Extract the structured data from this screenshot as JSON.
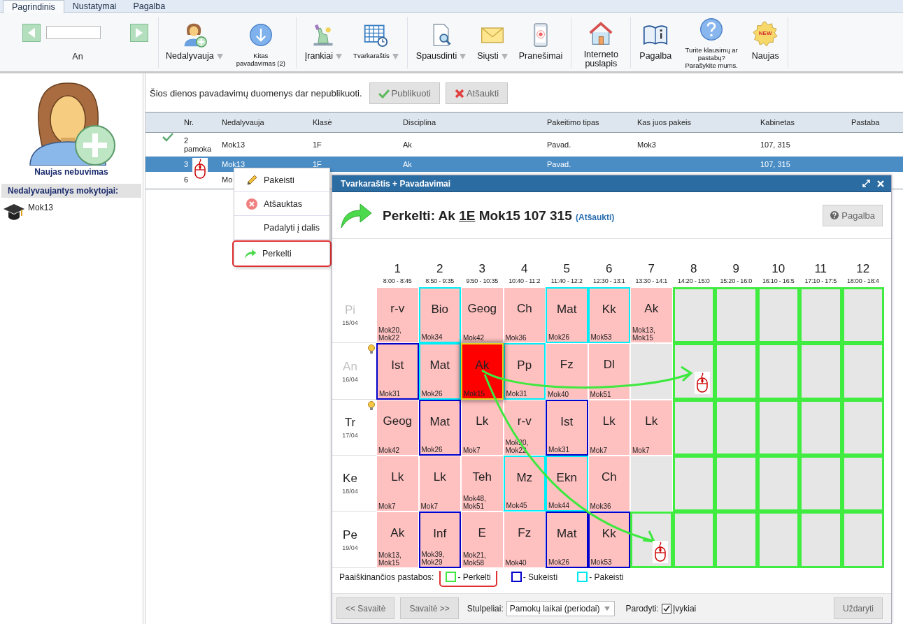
{
  "menu_tabs": [
    {
      "label": "Pagrindinis",
      "selected": true
    },
    {
      "label": "Nustatymai",
      "selected": false
    },
    {
      "label": "Pagalba",
      "selected": false
    }
  ],
  "toolbar": {
    "day_label": "An",
    "groups": [
      [
        {
          "label": "Nedalyvauja",
          "dropdown": true
        },
        {
          "label": "Kitas pavadavimas (2)",
          "dropdown": false
        }
      ],
      [
        {
          "label": "Įrankiai",
          "dropdown": true
        },
        {
          "label": "Tvarkaraštis",
          "dropdown": true
        }
      ],
      [
        {
          "label": "Spausdinti",
          "dropdown": true
        },
        {
          "label": "Siųsti",
          "dropdown": true
        },
        {
          "label": "Pranešimai",
          "dropdown": false
        }
      ],
      [
        {
          "label": "Interneto puslapis",
          "dropdown": false
        }
      ],
      [
        {
          "label": "Pagalba",
          "dropdown": false
        },
        {
          "label": "Turite klausimų ar pastabų? Parašykite mums.",
          "dropdown": false
        },
        {
          "label": "Naujas",
          "badge": "NEW",
          "dropdown": false
        }
      ]
    ]
  },
  "sidebar": {
    "new_absence": "Naujas nebuvimas",
    "heading": "Nedalyvaujantys mokytojai:",
    "teachers": [
      "Mok13"
    ]
  },
  "notice": {
    "text": "Šios dienos pavadavimų duomenys dar nepublikuoti.",
    "buttons": [
      "Publikuoti",
      "Atšaukti"
    ]
  },
  "table": {
    "columns": [
      "Nr.",
      "Nedalyvauja",
      "Klasė",
      "Disciplina",
      "Pakeitimo tipas",
      "Kas juos pakeis",
      "Kabinetas",
      "Pastaba"
    ],
    "rows": [
      {
        "published": true,
        "selected": false,
        "nr": "2\npamoka",
        "absent": "Mok13",
        "class": "1F",
        "subject": "Ak",
        "type": "Pavad.",
        "substitute": "Mok3",
        "room": "107, 315"
      },
      {
        "published": false,
        "selected": true,
        "nr": "3",
        "absent": "Mok13",
        "class": "1F",
        "subject": "Ak",
        "type": "Pavad.",
        "room": "107, 315"
      },
      {
        "published": false,
        "selected": false,
        "nr": "6",
        "absent": "Mo"
      }
    ]
  },
  "context_menu": [
    {
      "label": "Pakeisti",
      "highlighted": false
    },
    {
      "label": "Atšauktas",
      "highlighted": false
    },
    {
      "label": "Padalyti į dalis",
      "highlighted": false
    },
    {
      "label": "Perkelti",
      "highlighted": true
    }
  ],
  "dialog": {
    "title": "Tvarkaraštis + Pavadavimai",
    "heading": {
      "verb": "Perkelti: Ak",
      "class": "1E",
      "rest": "Mok15 107 315",
      "cancel_link": "(Atšaukti)"
    },
    "help_button": "Pagalba",
    "periods": [
      {
        "number": "1",
        "time": "8:00 - 8:45"
      },
      {
        "number": "2",
        "time": "8:50 - 9:35"
      },
      {
        "number": "3",
        "time": "9:50 - 10:35"
      },
      {
        "number": "4",
        "time": "10:40 - 11:2"
      },
      {
        "number": "5",
        "time": "11:40 - 12:2"
      },
      {
        "number": "6",
        "time": "12:30 - 13:1"
      },
      {
        "number": "7",
        "time": "13:30 - 14:1"
      },
      {
        "number": "8",
        "time": "14:20 - 15:0"
      },
      {
        "number": "9",
        "time": "15:20 - 16:0"
      },
      {
        "number": "10",
        "time": "16:10 - 16:5"
      },
      {
        "number": "11",
        "time": "17:10 - 17:5"
      },
      {
        "number": "12",
        "time": "18:00 - 18:4"
      }
    ],
    "days": [
      {
        "name": "Pi",
        "date": "15/04",
        "past": true,
        "hint": false,
        "cells": [
          {
            "subject": "r-v",
            "teachers": "Mok20, Mok22",
            "kind": "none"
          },
          {
            "subject": "Bio",
            "teachers": "Mok34",
            "kind": "replace"
          },
          {
            "subject": "Geog",
            "teachers": "Mok42",
            "kind": "none"
          },
          {
            "subject": "Ch",
            "teachers": "Mok36",
            "kind": "none"
          },
          {
            "subject": "Mat",
            "teachers": "Mok26",
            "kind": "replace"
          },
          {
            "subject": "Kk",
            "teachers": "Mok53",
            "kind": "replace"
          },
          {
            "subject": "Ak",
            "teachers": "Mok13, Mok15",
            "kind": "none"
          },
          {
            "kind": "move"
          },
          {
            "kind": "move"
          },
          {
            "kind": "move"
          },
          {
            "kind": "move"
          },
          {
            "kind": "move"
          }
        ]
      },
      {
        "name": "An",
        "date": "16/04",
        "past": true,
        "hint": true,
        "cells": [
          {
            "subject": "Ist",
            "teachers": "Mok31",
            "kind": "swap"
          },
          {
            "subject": "Mat",
            "teachers": "Mok26",
            "kind": "replace"
          },
          {
            "subject": "Ak",
            "teachers": "Mok15",
            "kind": "current"
          },
          {
            "subject": "Pp",
            "teachers": "Mok31",
            "kind": "replace"
          },
          {
            "subject": "Fz",
            "teachers": "Mok40",
            "kind": "none"
          },
          {
            "subject": "Dl",
            "teachers": "Mok51",
            "kind": "none"
          },
          {
            "kind": "none"
          },
          {
            "kind": "move"
          },
          {
            "kind": "move"
          },
          {
            "kind": "move"
          },
          {
            "kind": "move"
          },
          {
            "kind": "move"
          }
        ]
      },
      {
        "name": "Tr",
        "date": "17/04",
        "past": false,
        "hint": true,
        "cells": [
          {
            "subject": "Geog",
            "teachers": "Mok42",
            "kind": "none"
          },
          {
            "subject": "Mat",
            "teachers": "Mok26",
            "kind": "swap"
          },
          {
            "subject": "Lk",
            "teachers": "Mok7",
            "kind": "none"
          },
          {
            "subject": "r-v",
            "teachers": "Mok20, Mok22",
            "kind": "none"
          },
          {
            "subject": "Ist",
            "teachers": "Mok31",
            "kind": "swap"
          },
          {
            "subject": "Lk",
            "teachers": "Mok7",
            "kind": "none"
          },
          {
            "subject": "Lk",
            "teachers": "Mok7",
            "kind": "none"
          },
          {
            "kind": "move"
          },
          {
            "kind": "move"
          },
          {
            "kind": "move"
          },
          {
            "kind": "move"
          },
          {
            "kind": "move"
          }
        ]
      },
      {
        "name": "Ke",
        "date": "18/04",
        "past": false,
        "hint": false,
        "cells": [
          {
            "subject": "Lk",
            "teachers": "Mok7",
            "kind": "none"
          },
          {
            "subject": "Lk",
            "teachers": "Mok7",
            "kind": "none"
          },
          {
            "subject": "Teh",
            "teachers": "Mok48, Mok51",
            "kind": "none"
          },
          {
            "subject": "Mz",
            "teachers": "Mok45",
            "kind": "replace"
          },
          {
            "subject": "Ekn",
            "teachers": "Mok44",
            "kind": "replace"
          },
          {
            "subject": "Ch",
            "teachers": "Mok36",
            "kind": "none"
          },
          {
            "kind": "none"
          },
          {
            "kind": "move"
          },
          {
            "kind": "move"
          },
          {
            "kind": "move"
          },
          {
            "kind": "move"
          },
          {
            "kind": "move"
          }
        ]
      },
      {
        "name": "Pe",
        "date": "19/04",
        "past": false,
        "hint": false,
        "cells": [
          {
            "subject": "Ak",
            "teachers": "Mok13, Mok15",
            "kind": "none"
          },
          {
            "subject": "Inf",
            "teachers": "Mok39, Mok29",
            "kind": "swap"
          },
          {
            "subject": "E",
            "teachers": "Mok21, Mok58",
            "kind": "none"
          },
          {
            "subject": "Fz",
            "teachers": "Mok40",
            "kind": "none"
          },
          {
            "subject": "Mat",
            "teachers": "Mok26",
            "kind": "swap"
          },
          {
            "subject": "Kk",
            "teachers": "Mok53",
            "kind": "swap"
          },
          {
            "kind": "move"
          },
          {
            "kind": "move"
          },
          {
            "kind": "move"
          },
          {
            "kind": "move"
          },
          {
            "kind": "move"
          },
          {
            "kind": "move"
          }
        ]
      }
    ],
    "legend": {
      "label": "Paaiškinančios pastabos:",
      "items": [
        {
          "kind": "move",
          "label": "- Perkelti",
          "highlighted": true
        },
        {
          "kind": "swap",
          "label": "- Sukeisti",
          "highlighted": false
        },
        {
          "kind": "replace",
          "label": "- Pakeisti",
          "highlighted": false
        }
      ]
    },
    "footer": {
      "prev_week": "<< Savaitė",
      "next_week": "Savaitė >>",
      "columns_label": "Stulpeliai:",
      "columns_value": "Pamokų laikai (periodai)",
      "show_label": "Parodyti:",
      "events": {
        "label": "Įvykiai",
        "checked": true
      },
      "close": "Uždaryti"
    }
  }
}
